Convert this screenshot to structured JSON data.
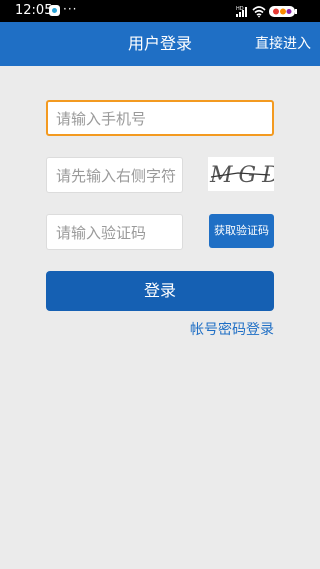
{
  "status_bar": {
    "time": "12:05",
    "more_indicator": "···",
    "network_label": "HD",
    "app_icon": "app-notification-icon",
    "icons": [
      "signal-icon",
      "wifi-icon",
      "battery-icon"
    ]
  },
  "header": {
    "title": "用户登录",
    "direct_enter_label": "直接进入",
    "background_color": "#1f6fc5"
  },
  "form": {
    "phone_placeholder": "请输入手机号",
    "captcha_placeholder": "请先输入右侧字符",
    "captcha_image_text": "MGD",
    "code_placeholder": "请输入验证码",
    "get_code_label": "获取验证码",
    "login_label": "登录",
    "account_login_label": "帐号密码登录"
  },
  "colors": {
    "primary": "#1f6fc5",
    "focus_border": "#f39a20",
    "background": "#ebebeb"
  }
}
